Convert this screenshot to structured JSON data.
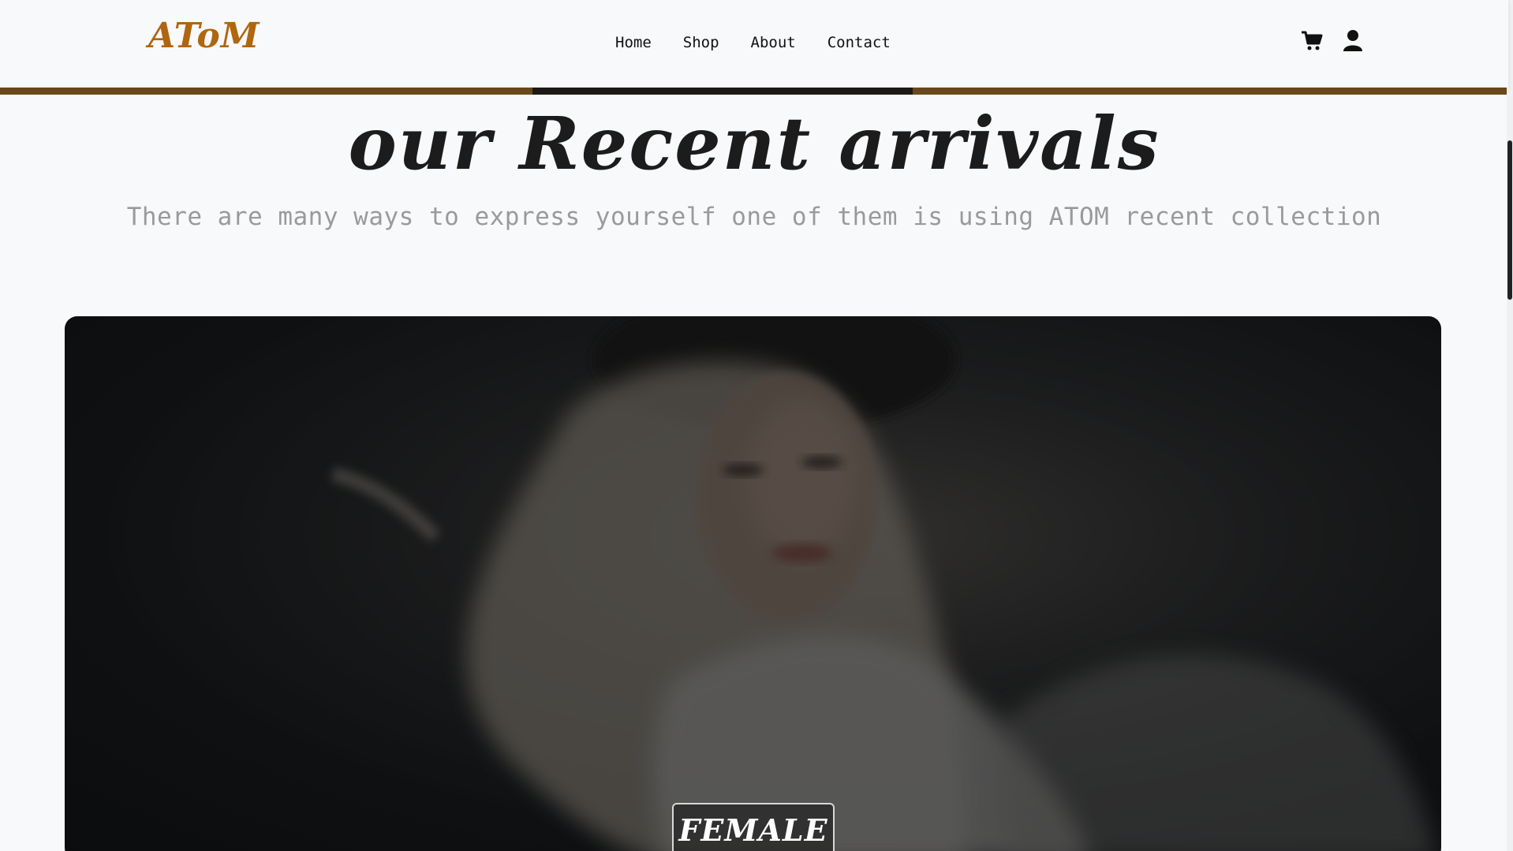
{
  "brand": {
    "logo_text": "AToM",
    "accent_color": "#b0650f"
  },
  "nav": {
    "links": [
      {
        "label": "Home"
      },
      {
        "label": "Shop"
      },
      {
        "label": "About"
      },
      {
        "label": "Contact"
      }
    ],
    "icons": [
      "cart-icon",
      "user-icon"
    ]
  },
  "section": {
    "title": "our Recent arrivals",
    "subtitle": "There are many ways to express yourself one of them is using ATOM recent collection"
  },
  "hero": {
    "label": "FEMALE",
    "image_description": "blurred photo of a blonde woman in a hat and knit sweater"
  }
}
